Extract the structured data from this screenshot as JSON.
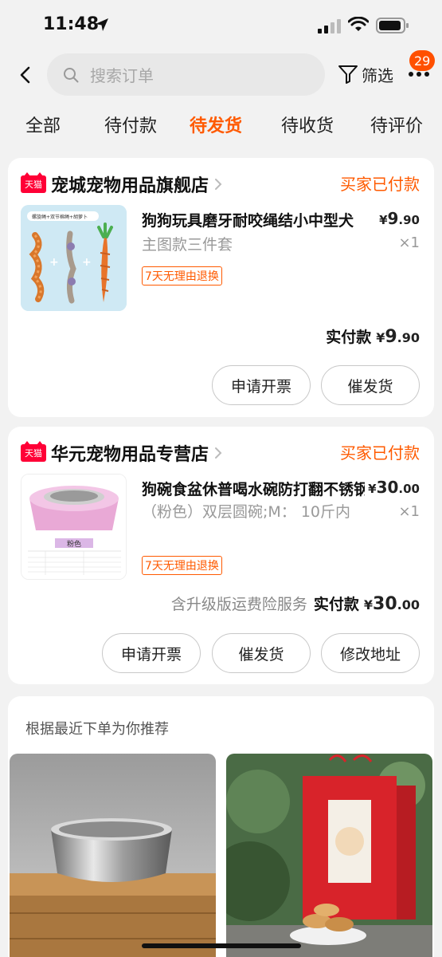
{
  "status_bar": {
    "time": "11:48"
  },
  "header": {
    "search_placeholder": "搜索订单",
    "filter_label": "筛选",
    "badge_count": "29"
  },
  "tabs": [
    {
      "label": "全部",
      "active": false
    },
    {
      "label": "待付款",
      "active": false
    },
    {
      "label": "待发货",
      "active": true
    },
    {
      "label": "待收货",
      "active": false
    },
    {
      "label": "待评价",
      "active": false
    }
  ],
  "orders": [
    {
      "shop_badge": "天猫",
      "shop_name": "宠城宠物用品旗舰店",
      "status": "买家已付款",
      "product_title": "狗狗玩具磨牙耐咬绳结小中型犬",
      "product_image_caption": "螺旋绳+双节棉绳+胡萝卜",
      "price_symbol": "¥",
      "price_int": "9",
      "price_dec": ".90",
      "spec": "主图款三件套",
      "qty": "×1",
      "return_tag": "7天无理由退换",
      "paid_note": "",
      "paid_label": "实付款",
      "paid_symbol": "¥",
      "paid_int": "9",
      "paid_dec": ".90",
      "buttons": [
        "申请开票",
        "催发货"
      ]
    },
    {
      "shop_badge": "天猫",
      "shop_name": "华元宠物用品专营店",
      "status": "买家已付款",
      "product_title": "狗碗食盆休普喝水碗防打翻不锈钢",
      "product_image_caption": "粉色",
      "price_symbol": "¥",
      "price_int": "30",
      "price_dec": ".00",
      "spec": "（粉色）双层圆碗;M： 10斤内",
      "qty": "×1",
      "return_tag": "7天无理由退换",
      "paid_note": "含升级版运费险服务",
      "paid_label": "实付款",
      "paid_symbol": "¥",
      "paid_int": "30",
      "paid_dec": ".00",
      "buttons": [
        "申请开票",
        "催发货",
        "修改地址"
      ]
    }
  ],
  "recommend": {
    "title": "根据最近下单为你推荐"
  },
  "colors": {
    "accent": "#ff5a00",
    "tmall": "#ff0036"
  }
}
